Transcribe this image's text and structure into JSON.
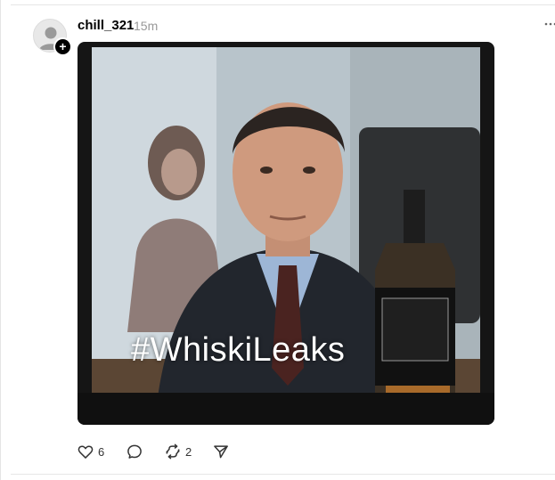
{
  "post": {
    "username": "chill_321",
    "timestamp": "15m",
    "more_icon": "more-horizontal-icon",
    "image_overlay_text": "#WhiskiLeaks",
    "actions": {
      "like": {
        "icon": "heart-icon",
        "count": "6"
      },
      "reply": {
        "icon": "comment-icon",
        "count": ""
      },
      "repost": {
        "icon": "repost-icon",
        "count": "2"
      },
      "share": {
        "icon": "send-icon",
        "count": ""
      }
    }
  },
  "colors": {
    "text_primary": "#000000",
    "text_secondary": "#999999",
    "media_frame": "#151515",
    "divider": "#e6e6e6"
  }
}
